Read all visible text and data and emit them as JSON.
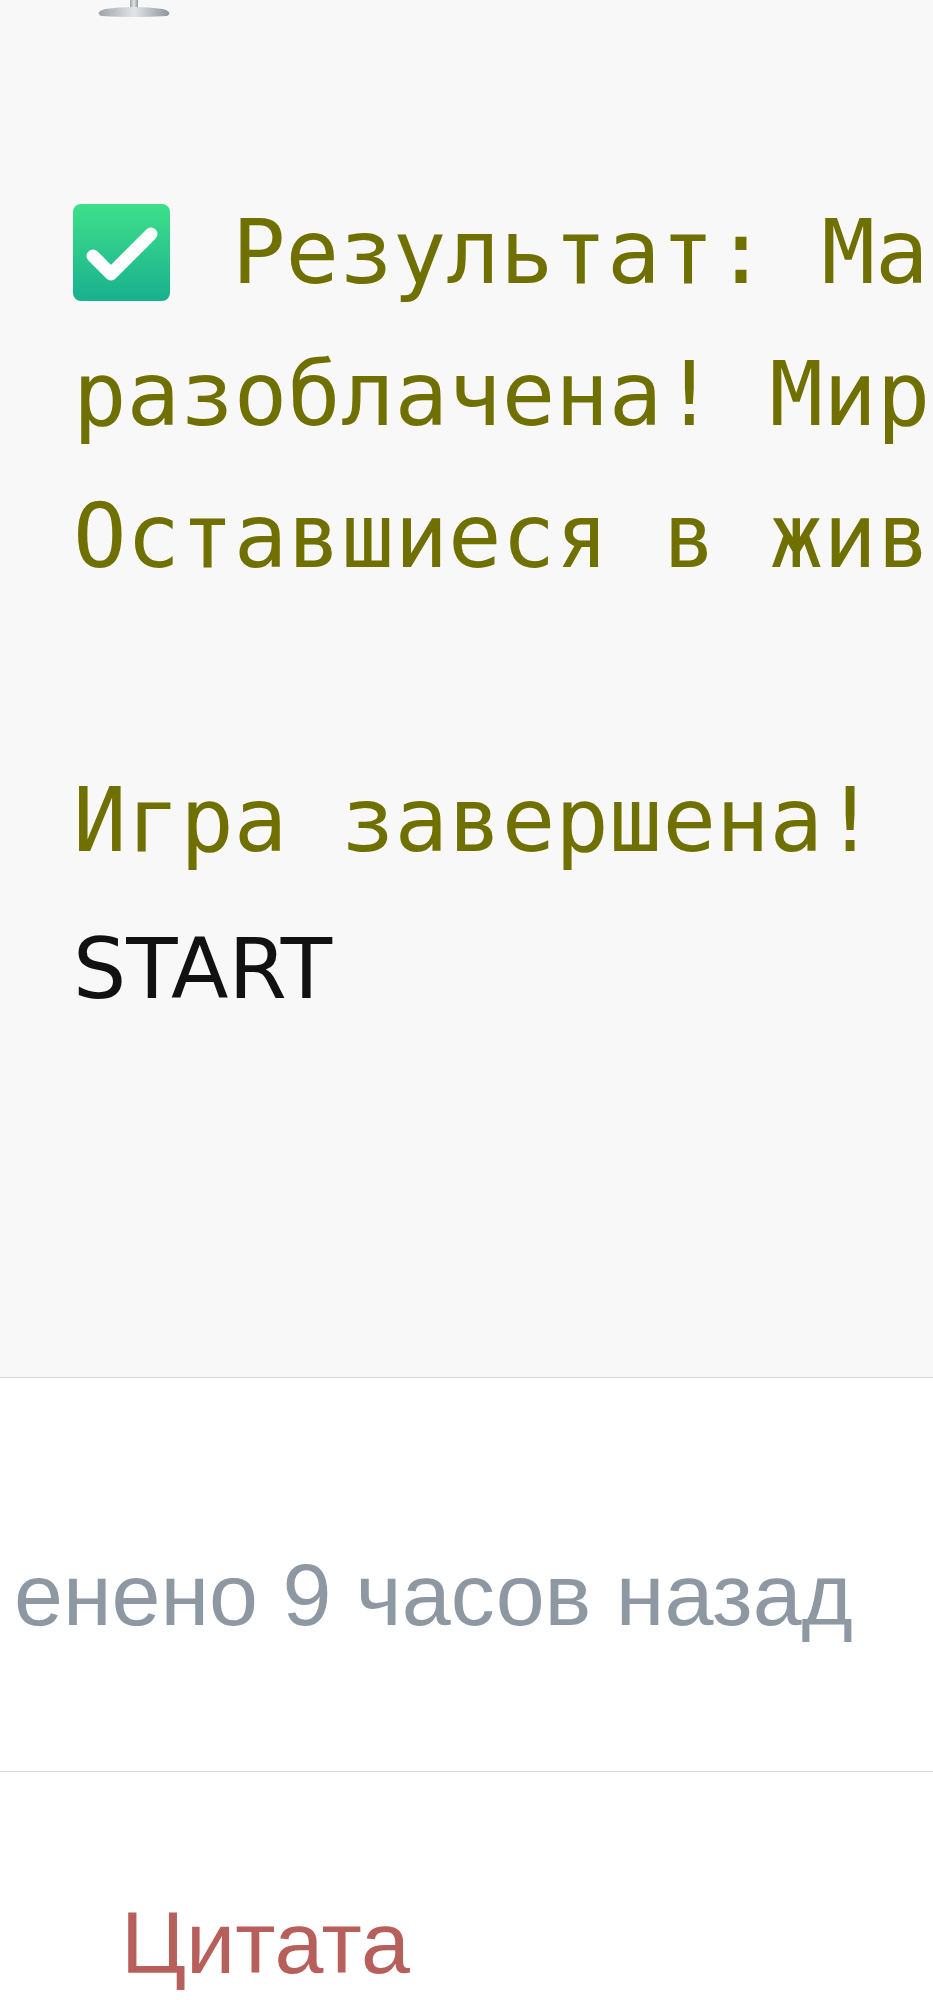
{
  "code_block": {
    "lines": [
      {
        "kind": "result",
        "text": "Результат: Ма"
      },
      {
        "kind": "text",
        "text": "разоблачена! Мир"
      },
      {
        "kind": "text",
        "text": "Оставшиеся в жив"
      },
      {
        "kind": "blank"
      },
      {
        "kind": "text",
        "text": "Игра завершена!"
      },
      {
        "kind": "plain",
        "text": "START"
      }
    ]
  },
  "edited": {
    "text": "енено 9 часов назад"
  },
  "quote_link": {
    "label": "Цитата"
  }
}
